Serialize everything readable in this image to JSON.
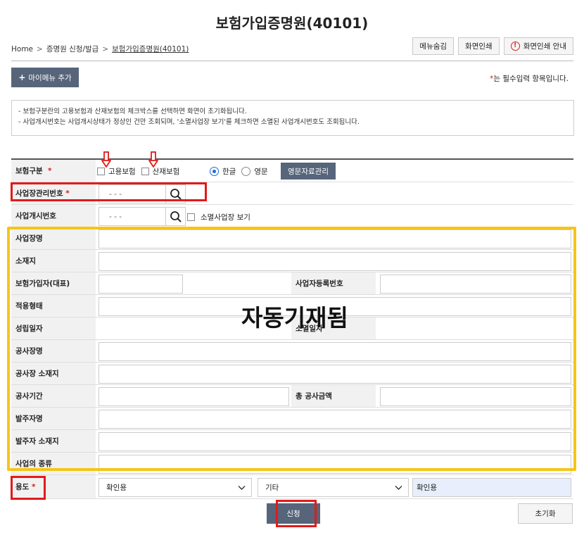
{
  "page": {
    "title": "보험가입증명원(40101)"
  },
  "breadcrumb": {
    "home": "Home",
    "level1": "증명원 신청/발급",
    "current": "보험가입증명원(40101)"
  },
  "top_buttons": {
    "hide_menu": "메뉴숨김",
    "print": "화면인쇄",
    "print_guide": "화면인쇄 안내"
  },
  "my_menu": {
    "label": "마이메뉴 추가",
    "plus": "+"
  },
  "required_note": {
    "mark": "*",
    "text": "는 필수입력 항목입니다."
  },
  "notice": {
    "line1": "- 보험구분란의 고용보험과 산재보험의 체크박스를 선택하면 화면이 초기화됩니다.",
    "line2": "- 사업개시번호는 사업개시상태가 정상인 건만 조회되며, '소멸사업장 보기'를 체크하면 소멸된 사업개시번호도 조회됩니다."
  },
  "form": {
    "insurance_type": {
      "label": "보험구분",
      "req": "*",
      "employment": "고용보험",
      "industrial": "산재보험",
      "korean": "한글",
      "english": "영문",
      "english_manage": "영문자료관리",
      "language_selected": "한글"
    },
    "business_mgmt_no": {
      "label": "사업장관리번호",
      "req": "*",
      "placeholder": "- -  -"
    },
    "business_start_no": {
      "label": "사업개시번호",
      "placeholder": "- -  -",
      "show_closed": "소멸사업장 보기"
    },
    "business_name": {
      "label": "사업장명"
    },
    "address": {
      "label": "소재지"
    },
    "representative": {
      "label": "보험가입자(대표)",
      "reg_no_label": "사업자등록번호"
    },
    "application_type": {
      "label": "적용형태"
    },
    "establish_date": {
      "label": "성립일자",
      "close_date_label": "소멸일자"
    },
    "construction_name": {
      "label": "공사장명"
    },
    "construction_address": {
      "label": "공사장 소재지"
    },
    "construction_period": {
      "label": "공사기간",
      "total_amount_label": "총 공사금액"
    },
    "client_name": {
      "label": "발주자명"
    },
    "client_address": {
      "label": "발주자 소재지"
    },
    "business_kind": {
      "label": "사업의 종류"
    },
    "purpose": {
      "label": "용도",
      "req": "*",
      "select1": "확인용",
      "select2": "기타",
      "value": "확인용"
    }
  },
  "annotation": {
    "auto_fill": "자동기재됨"
  },
  "actions": {
    "submit": "신청",
    "reset": "초기화"
  },
  "colors": {
    "dark_button": "#56657a",
    "annotation_red": "#e11a1a",
    "annotation_yellow": "#f5c518",
    "radio_blue": "#1a6fd8"
  }
}
